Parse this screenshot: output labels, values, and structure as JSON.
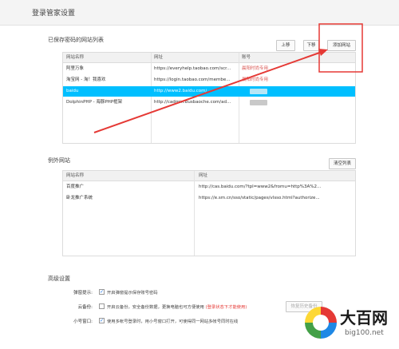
{
  "window": {
    "title": "登录管家设置"
  },
  "saved_sites": {
    "title": "已保存密码的网站列表",
    "buttons": {
      "up": "上移",
      "down": "下移",
      "add": "添加网站"
    },
    "columns": [
      "网站名称",
      "网址",
      "账号"
    ],
    "rows": [
      {
        "name": "阿里万象",
        "url": "https://everyhelp.taobao.com/scr...",
        "account": "晨阳时尚专用"
      },
      {
        "name": "淘宝网 - 淘！我喜欢",
        "url": "https://login.taobao.com/membe...",
        "account": "晨阳时尚专用"
      },
      {
        "name": "baidu",
        "url": "http://www2.baidu.com/",
        "account": ""
      },
      {
        "name": "DolphinPHP - 海豚PHP框架",
        "url": "http://cadmin.busbaoche.com/ad...",
        "account": ""
      }
    ]
  },
  "exception_sites": {
    "title": "例外网站",
    "buttons": {
      "clear": "清空列表"
    },
    "columns": [
      "网站名称",
      "网址"
    ],
    "rows": [
      {
        "name": "百度推广",
        "url": "http://cas.baidu.com/?tpl=www2&fromu=http%3A%2..."
      },
      {
        "name": "卧龙推广系统",
        "url": "https://e.sm.cn/sso/static/pages/vlsso.html?authorize..."
      }
    ]
  },
  "advanced": {
    "title": "高级设置",
    "options": [
      {
        "label": "弹窗提示:",
        "checked": true,
        "text": "开启弹窗提示保存账号密码",
        "note": ""
      },
      {
        "label": "云备份:",
        "checked": false,
        "text": "开启云备份，安全备份数据，更换电脑也可方便使用",
        "note": "(登录状态下才能使用)"
      },
      {
        "label": "小号窗口:",
        "checked": true,
        "text": "使用多帐号登录时，用小号窗口打开，可使得同一网站多帐号同时在线",
        "note": ""
      }
    ],
    "history_button": "恢复历史备份"
  },
  "watermark": {
    "big": "大百网",
    "small": "big100.net"
  },
  "colors": {
    "selected_row": "#00bfff",
    "annotation_red": "#e53935"
  }
}
